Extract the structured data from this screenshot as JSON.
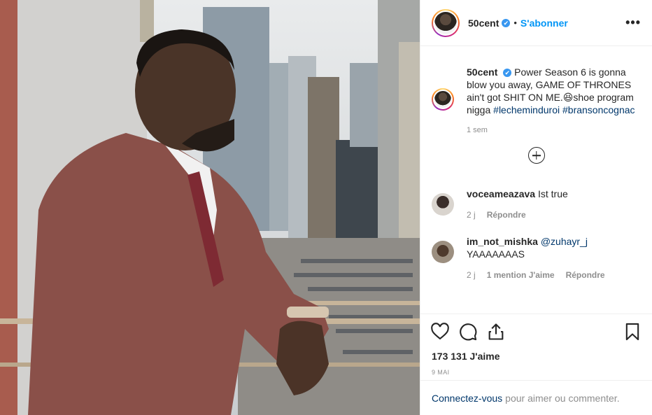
{
  "header": {
    "username": "50cent",
    "verified_mark": "✔",
    "separator": "•",
    "follow_label": "S'abonner",
    "more_label": "•••"
  },
  "caption": {
    "username": "50cent",
    "text_before": "Power Season 6 is gonna blow you away, GAME OF THRONES ain't got SHIT ON ME.😆shoe program nigga ",
    "hashtag1": "#lecheminduroi",
    "hashtag2": "#bransoncognac",
    "time": "1 sem"
  },
  "comments": [
    {
      "username": "voceameazava",
      "text": "Ist true",
      "time": "2 j",
      "reply_label": "Répondre"
    },
    {
      "username": "im_not_mishka",
      "mention": "@zuhayr_j",
      "text": "YAAAAAAAS",
      "time": "2 j",
      "likes_label": "1 mention J'aime",
      "reply_label": "Répondre"
    }
  ],
  "actions": {
    "like_icon": "heart-icon",
    "comment_icon": "comment-icon",
    "share_icon": "share-icon",
    "save_icon": "bookmark-icon",
    "likes": "173 131 J'aime",
    "date": "9 MAI"
  },
  "footer": {
    "login_link": "Connectez-vous",
    "login_text": "pour aimer ou commenter."
  },
  "colors": {
    "link_blue": "#0095f6",
    "hashtag_blue": "#00376b",
    "muted": "#8e8e8e",
    "suit": "#8a5049"
  }
}
